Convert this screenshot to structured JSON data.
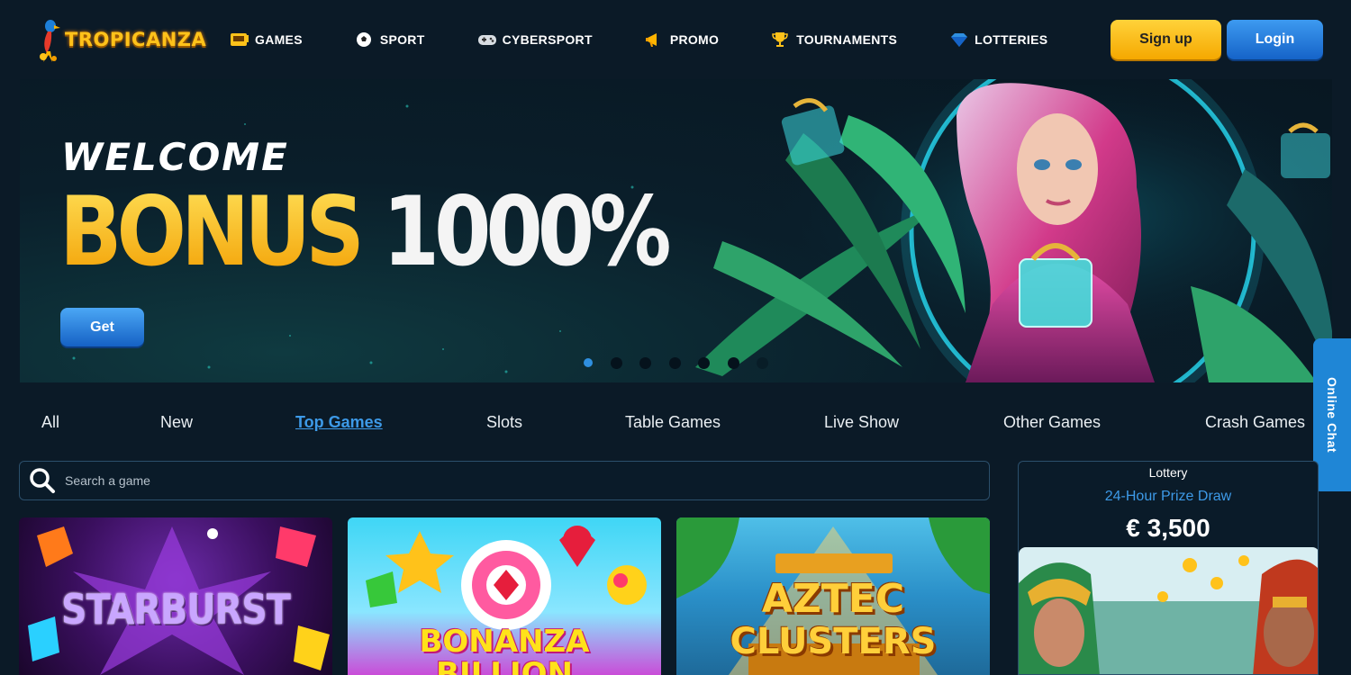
{
  "brand": {
    "name": "TROPICANZA"
  },
  "nav": {
    "items": [
      {
        "label": "GAMES",
        "icon": "slot-machine-icon"
      },
      {
        "label": "SPORT",
        "icon": "soccer-ball-icon"
      },
      {
        "label": "CYBERSPORT",
        "icon": "gamepad-icon"
      },
      {
        "label": "PROMO",
        "icon": "megaphone-icon"
      },
      {
        "label": "TOURNAMENTS",
        "icon": "trophy-icon"
      },
      {
        "label": "LOTTERIES",
        "icon": "diamond-icon"
      }
    ]
  },
  "auth": {
    "signup_label": "Sign up",
    "login_label": "Login"
  },
  "hero": {
    "title_line1": "WELCOME",
    "title_bonus": "BONUS",
    "title_percent": "1000%",
    "cta_label": "Get",
    "slides_count": 7,
    "active_slide": 0
  },
  "chat": {
    "label": "Online Chat"
  },
  "categories": {
    "items": [
      "All",
      "New",
      "Top Games",
      "Slots",
      "Table Games",
      "Live Show",
      "Other Games",
      "Crash Games"
    ],
    "active": "Top Games"
  },
  "search": {
    "placeholder": "Search a game"
  },
  "games": [
    {
      "title": "STARBURST"
    },
    {
      "title_line1": "BONANZA",
      "title_line2": "BILLION"
    },
    {
      "title_line1": "AZTEC",
      "title_line2": "CLUSTERS"
    }
  ],
  "lottery": {
    "label": "Lottery",
    "subtitle": "24-Hour Prize Draw",
    "amount": "€ 3,500"
  },
  "colors": {
    "background": "#0b1a27",
    "accent_blue": "#3d9ae8",
    "signup_yellow": "#f5b800",
    "login_blue": "#1f6fd0",
    "bonus_gold": "#ffc21a"
  }
}
